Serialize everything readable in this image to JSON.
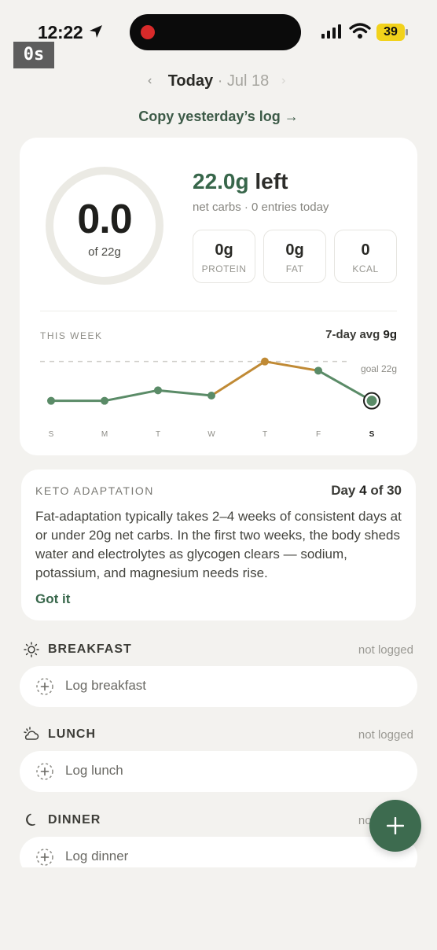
{
  "status_bar": {
    "time": "12:22",
    "recording_timer": "0s",
    "battery": "39"
  },
  "date_nav": {
    "today": "Today",
    "separator": "·",
    "date": "Jul 18",
    "copy_log": "Copy yesterday’s log →"
  },
  "summary": {
    "ring_value": "0.0",
    "ring_sub": "of 22g",
    "ring_progress": 0,
    "remaining_amount": "22.0g",
    "remaining_word": "left",
    "net_sub": "net carbs · 0 entries today",
    "macros": [
      {
        "value": "0g",
        "label": "PROTEIN"
      },
      {
        "value": "0g",
        "label": "FAT"
      },
      {
        "value": "0",
        "label": "KCAL"
      }
    ],
    "week_label": "THIS WEEK",
    "week_avg_prefix": "7-day avg",
    "week_avg_value": "9g"
  },
  "chart_data": {
    "type": "line",
    "categories": [
      "S",
      "M",
      "T",
      "W",
      "T",
      "F",
      "S"
    ],
    "values": [
      7,
      7,
      11,
      9,
      22,
      18.5,
      7
    ],
    "over_goal_color": "#c08a35",
    "line_color": "#5a8b67",
    "goal": 22,
    "goal_label": "goal 22g",
    "ylim": [
      0,
      24
    ],
    "highlight_index": 6
  },
  "keto": {
    "title": "KETO ADAPTATION",
    "day_prefix": "Day",
    "day_current": "4",
    "day_suffix": "of 30",
    "body": "Fat-adaptation typically takes 2–4 weeks of consistent days at or under 20g net carbs. In the first two weeks, the body sheds water and electrolytes as glycogen clears — sodium, potassium, and magnesium needs rise.",
    "action": "Got it"
  },
  "meals": {
    "breakfast": {
      "title": "BREAKFAST",
      "status": "not logged",
      "action": "Log breakfast",
      "icon": "sun-icon"
    },
    "lunch": {
      "title": "LUNCH",
      "status": "not logged",
      "action": "Log lunch",
      "icon": "cloud-sun-icon"
    },
    "dinner": {
      "title": "DINNER",
      "status": "not logged",
      "action": "Log dinner",
      "icon": "moon-icon"
    }
  },
  "colors": {
    "accent": "#37664a",
    "fab": "#3d6b4f",
    "background": "#f3f2ef"
  }
}
